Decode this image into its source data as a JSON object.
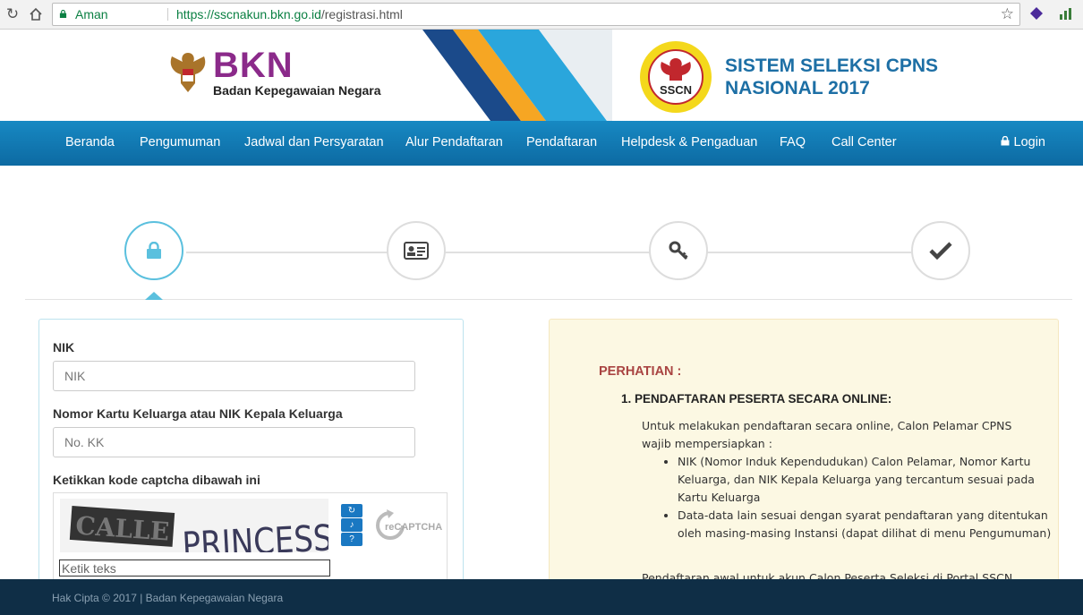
{
  "browser": {
    "secure_label": "Aman",
    "url_host": "https://sscnakun.bkn.go.id",
    "url_path": "/registrasi.html"
  },
  "header": {
    "bkn_name": "BKN",
    "bkn_full": "Badan Kepegawaian Negara",
    "sscn_line1": "SISTEM SELEKSI CPNS",
    "sscn_line2": "NASIONAL 2017",
    "sscn_badge": "SSCN"
  },
  "nav": {
    "items": [
      "Beranda",
      "Pengumuman",
      "Jadwal dan Persyaratan",
      "Alur Pendaftaran",
      "Pendaftaran",
      "Helpdesk & Pengaduan",
      "FAQ",
      "Call Center"
    ],
    "login": "Login"
  },
  "steps": [
    "lock-icon",
    "id-card-icon",
    "key-icon",
    "check-icon"
  ],
  "form": {
    "nik_label": "NIK",
    "nik_placeholder": "NIK",
    "kk_label": "Nomor Kartu Keluarga atau NIK Kepala Keluarga",
    "kk_placeholder": "No. KK",
    "captcha_label": "Ketikkan kode captcha dibawah ini",
    "captcha_word1": "CALLE",
    "captcha_word2": "PRINCESS",
    "captcha_placeholder": "Ketik teks",
    "recaptcha_logo": "reCAPTCHA"
  },
  "info": {
    "title": "PERHATIAN :",
    "heading": "1. PENDAFTARAN PESERTA SECARA ONLINE:",
    "intro": "Untuk melakukan pendaftaran secara online, Calon Pelamar CPNS wajib mempersiapkan :",
    "bullets": [
      "NIK (Nomor Induk Kependudukan) Calon Pelamar, Nomor Kartu Keluarga, dan NIK Kepala Keluarga yang tercantum sesuai pada Kartu Keluarga",
      "Data-data lain sesuai dengan syarat pendaftaran yang ditentukan oleh masing-masing Instansi (dapat dilihat di menu Pengumuman)"
    ],
    "more": "Pendaftaran awal untuk akun Calon Peserta Seleksi di Portal SSCN"
  },
  "footer": {
    "copyright": "Hak Cipta © 2017 | Badan Kepegawaian Negara"
  },
  "colors": {
    "nav": "#1789c3",
    "bkn_purple": "#8b2a8a",
    "sscn_blue": "#1d6fa5",
    "alert_red": "#a94442",
    "step_active": "#5bc0de",
    "footer": "#0f2e46"
  }
}
